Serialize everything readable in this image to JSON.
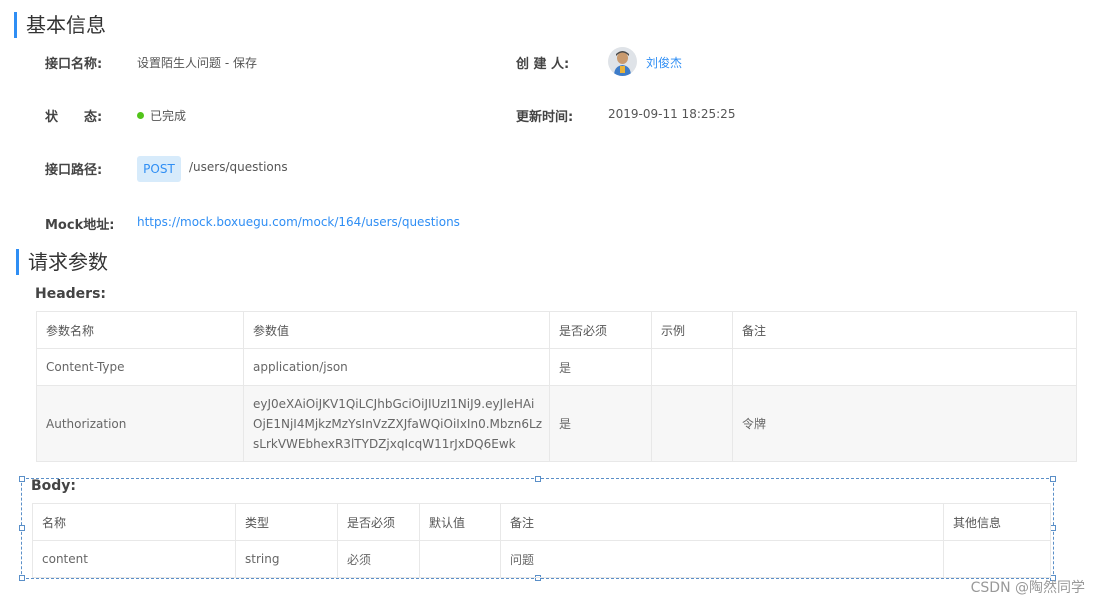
{
  "basic": {
    "title": "基本信息",
    "api_name_label": "接口名称:",
    "api_name": "设置陌生人问题 - 保存",
    "creator_label": "创 建 人:",
    "creator": "刘俊杰",
    "status_label": "状　　态:",
    "status": "已完成",
    "status_color": "#52c41a",
    "updated_label": "更新时间:",
    "updated": "2019-09-11 18:25:25",
    "path_label": "接口路径:",
    "method": "POST",
    "path": "/users/questions",
    "mock_label": "Mock地址:",
    "mock_url": "https://mock.boxuegu.com/mock/164/users/questions"
  },
  "request": {
    "title": "请求参数",
    "headers_label": "Headers:",
    "headers_columns": [
      "参数名称",
      "参数值",
      "是否必须",
      "示例",
      "备注"
    ],
    "headers_rows": [
      [
        "Content-Type",
        "application/json",
        "是",
        "",
        ""
      ],
      [
        "Authorization",
        "eyJ0eXAiOiJKV1QiLCJhbGciOiJIUzI1NiJ9.eyJleHAiOjE1NjI4MjkzMzYsInVzZXJfaWQiOiIxIn0.Mbzn6LzsLrkVWEbhexR3lTYDZjxqIcqW11rJxDQ6Ewk",
        "是",
        "",
        "令牌"
      ]
    ],
    "body_label": "Body:",
    "body_columns": [
      "名称",
      "类型",
      "是否必须",
      "默认值",
      "备注",
      "其他信息"
    ],
    "body_rows": [
      [
        "content",
        "string",
        "必须",
        "",
        "问题",
        ""
      ]
    ]
  },
  "watermark": "CSDN @陶然同学",
  "accent_color": "#2f8ef4"
}
